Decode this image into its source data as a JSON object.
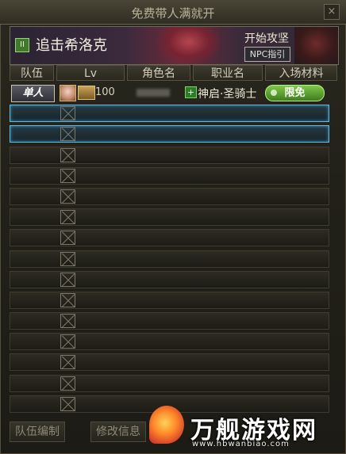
{
  "window": {
    "title": "免费带人满就开"
  },
  "banner": {
    "dungeon_name": "追击希洛克",
    "guide_title": "开始攻坚",
    "npc_button": "NPC指引"
  },
  "table": {
    "headers": [
      "队伍",
      "Lv",
      "角色名",
      "职业名",
      "入场材料"
    ],
    "first_row": {
      "team_badge": "单人",
      "level": "100",
      "job": "神启·圣骑士",
      "material": "限免"
    },
    "empty_rows": 15
  },
  "bottom": {
    "team_edit": "队伍编制",
    "modify_info": "修改信息"
  },
  "watermark": {
    "text": "万舰游戏网",
    "url": "www.hbwanbiao.com"
  },
  "colors": {
    "selected_border": "#5fb8e0",
    "limited_badge": "#5fa83a"
  }
}
